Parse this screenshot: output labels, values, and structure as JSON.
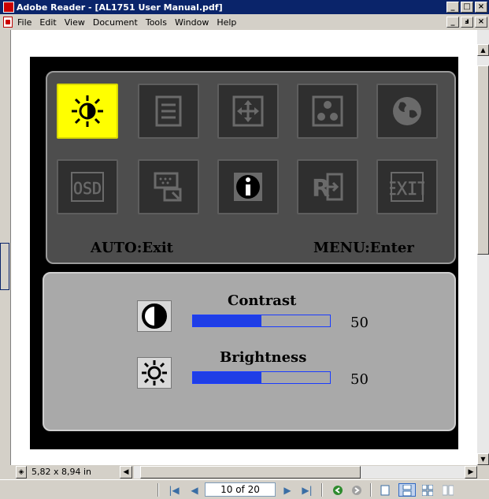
{
  "window": {
    "title": "Adobe Reader - [AL1751 User Manual.pdf]",
    "controls": [
      "_",
      "□",
      "×"
    ],
    "doc_controls": [
      "_",
      "ⅎ",
      "×"
    ]
  },
  "menu": {
    "items": [
      "File",
      "Edit",
      "View",
      "Document",
      "Tools",
      "Window",
      "Help"
    ]
  },
  "osd": {
    "icons": [
      "brightness-icon",
      "picture-icon",
      "position-icon",
      "color-icon",
      "language-icon",
      "osd-settings-icon",
      "input-select-icon",
      "information-icon",
      "reset-icon",
      "exit-icon"
    ],
    "selected_index": 0,
    "hint_left": "AUTO:Exit",
    "hint_right": "MENU:Enter",
    "controls": [
      {
        "label": "Contrast",
        "value": "50",
        "level": 0.5
      },
      {
        "label": "Brightness",
        "value": "50",
        "level": 0.5
      }
    ]
  },
  "statusbar": {
    "page_size": "5,82 x 8,94 in"
  },
  "navigation": {
    "page_indicator": "10 of 20"
  },
  "colors": {
    "title_bar": "#0a246a",
    "selected_tile": "#ffff00",
    "bar_fill": "#1f3ee6",
    "bar_border": "#1a3cff"
  }
}
